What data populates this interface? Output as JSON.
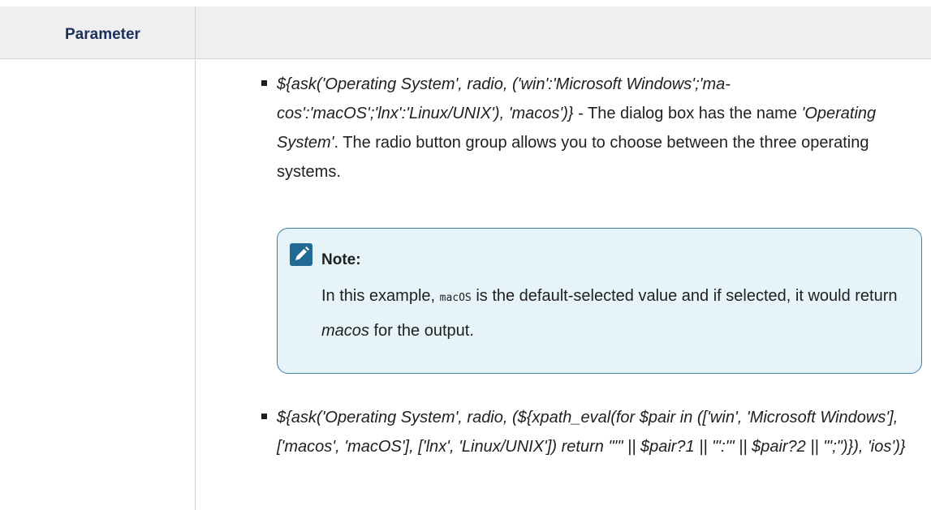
{
  "table": {
    "header_parameter": "Parameter"
  },
  "item1": {
    "code": "${ask('Operating System', radio, ('win':'Microsoft Windows';'ma-cos':'macOS';'lnx':'Linux/UNIX'), 'macos')}",
    "desc_part1": " - The dialog box has the name ",
    "name_italic": "'Operating System'",
    "desc_part2": ". The radio button group allows you to choose between the three operating systems."
  },
  "note": {
    "icon": "pencil-icon",
    "title": "Note:",
    "text_part1": "In this example, ",
    "code": "macOS",
    "text_part2": " is the default-selected value and if selected, it would return ",
    "italic": "macos",
    "text_part3": " for the output."
  },
  "item2": {
    "code": "${ask('Operating System', radio, (${xpath_eval(for $pair in (['win', 'Microsoft Windows'], ['macos', 'macOS'], ['lnx', 'Linux/UNIX']) return \"'\" || $pair?1 || \"':'\" || $pair?2 || \"';\")}), 'ios')}"
  }
}
